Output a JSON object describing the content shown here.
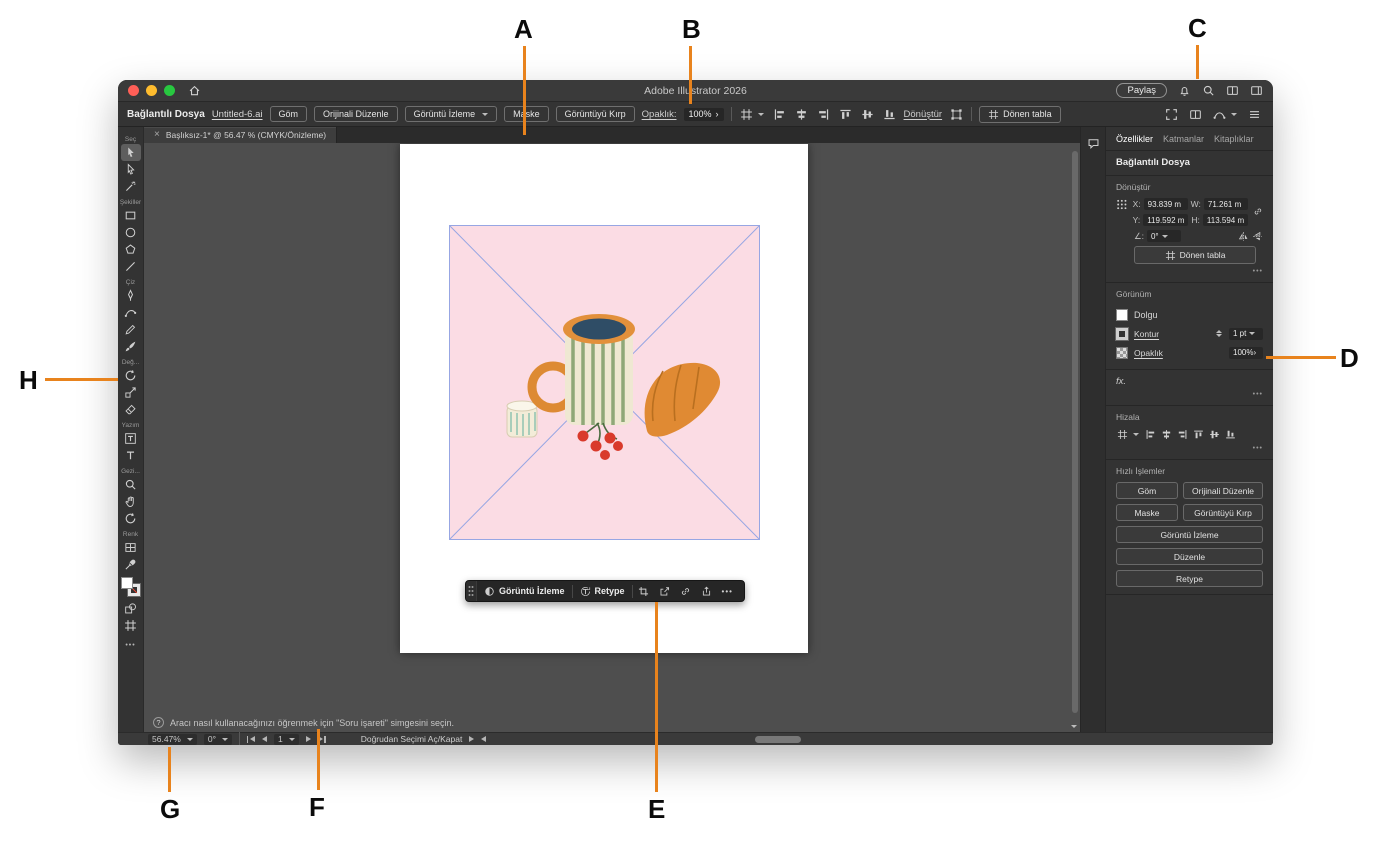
{
  "annotations": {
    "line_color": "#E8831D",
    "labels": [
      "A",
      "B",
      "C",
      "D",
      "E",
      "F",
      "G",
      "H"
    ]
  },
  "colors": {
    "traffic_red": "#FF5F57",
    "traffic_yellow": "#FEBC2E",
    "traffic_green": "#28C840",
    "placeholder_pink": "#FBDCE4",
    "frame_blue": "#97A6E3"
  },
  "titlebar": {
    "title": "Adobe Illustrator 2026",
    "share_button": "Paylaş"
  },
  "control_bar": {
    "context_label": "Bağlantılı Dosya",
    "filename_link": "Untitled-6.ai",
    "embed_button": "Göm",
    "edit_original_button": "Orijinali Düzenle",
    "image_trace_button": "Görüntü İzleme",
    "mask_button": "Maske",
    "crop_image_button": "Görüntüyü Kırp",
    "opacity_label": "Opaklık:",
    "opacity_value": "100%",
    "transform_label": "Dönüştür",
    "artboard_button": "Dönen tabla"
  },
  "document_tab": {
    "title": "Başlıksız-1* @ 56.47 % (CMYK/Önizleme)"
  },
  "tools_panel": {
    "sections": [
      {
        "label": "Seç",
        "tools": [
          "selection",
          "direct-selection",
          "magic-wand"
        ]
      },
      {
        "label": "Şekiller",
        "tools": [
          "rectangle",
          "ellipse",
          "polygon",
          "line-segment"
        ]
      },
      {
        "label": "Çiz",
        "tools": [
          "pen",
          "curvature",
          "pencil",
          "paintbrush"
        ]
      },
      {
        "label": "Değ...",
        "tools": [
          "rotate",
          "scale",
          "eraser"
        ]
      },
      {
        "label": "Yazım",
        "tools": [
          "touch-type",
          "type"
        ]
      },
      {
        "label": "Gezi...",
        "tools": [
          "zoom",
          "hand",
          "rotate-view"
        ]
      },
      {
        "label": "Renk",
        "tools": [
          "swatches",
          "eyedropper",
          "shape-builder"
        ]
      }
    ]
  },
  "context_taskbar": {
    "image_trace_button": "Görüntü İzleme",
    "retype_button": "Retype"
  },
  "hint_bar": {
    "text": "Aracı nasıl kullanacağınızı öğrenmek için \"Soru işareti\" simgesini seçin."
  },
  "status_bar": {
    "zoom_value": "56.47%",
    "rotation_value": "0°",
    "artboard_number": "1",
    "tool_name": "Doğrudan Seçimi Aç/Kapat"
  },
  "properties_panel": {
    "tabs": [
      "Özellikler",
      "Katmanlar",
      "Kitaplıklar"
    ],
    "selection_type": "Bağlantılı Dosya",
    "transform": {
      "title": "Dönüştür",
      "x_label": "X:",
      "x_value": "93.839 m",
      "y_label": "Y:",
      "y_value": "119.592 m",
      "w_label": "W:",
      "w_value": "71.261 m",
      "h_label": "H:",
      "h_value": "113.594 m",
      "angle_label": "∠:",
      "angle_value": "0°",
      "artboard_button": "Dönen tabla"
    },
    "appearance": {
      "title": "Görünüm",
      "fill_label": "Dolgu",
      "stroke_label": "Kontur",
      "stroke_value": "1 pt",
      "opacity_label": "Opaklık",
      "opacity_value": "100%",
      "fx_label": "fx."
    },
    "align": {
      "title": "Hizala"
    },
    "quick_actions": {
      "title": "Hızlı İşlemler",
      "buttons": [
        "Göm",
        "Orijinali Düzenle",
        "Maske",
        "Görüntüyü Kırp",
        "Görüntü İzleme",
        "Düzenle",
        "Retype"
      ]
    }
  },
  "ui": {
    "more": "•••",
    "close_glyph": "×",
    "help_glyph": "?",
    "chevron_right": "›"
  }
}
